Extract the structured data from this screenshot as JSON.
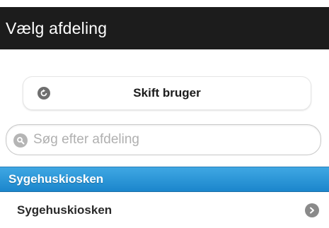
{
  "header": {
    "title": "Vælg afdeling"
  },
  "switch_user": {
    "label": "Skift bruger",
    "icon": "refresh-icon"
  },
  "search": {
    "placeholder": "Søg efter afdeling",
    "value": "",
    "icon": "search-icon"
  },
  "list": {
    "divider_label": "Sygehuskiosken",
    "items": [
      {
        "label": "Sygehuskiosken",
        "icon": "chevron-right-icon"
      }
    ]
  },
  "colors": {
    "header_bg": "#1c1c1c",
    "divider_bg": "#2a96d8",
    "icon_gray": "#8a8a8a"
  }
}
